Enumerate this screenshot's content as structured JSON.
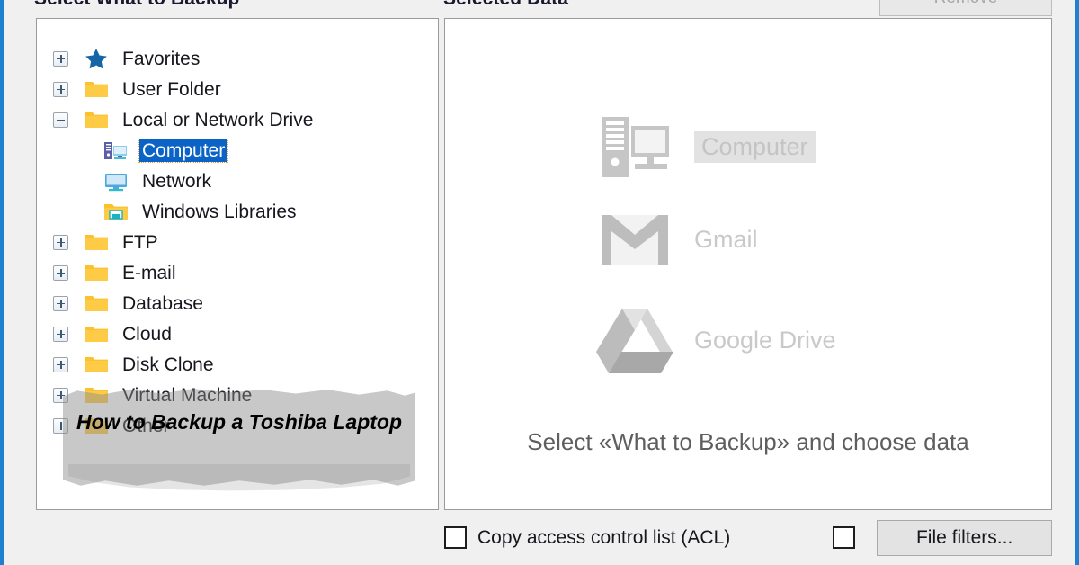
{
  "window": {
    "accent_border_color": "#1f7fd0",
    "background_color": "#f0f0f0"
  },
  "headers": {
    "left": "Select What to Backup",
    "right": "Selected Data"
  },
  "toolbar": {
    "remove_label": "Remove",
    "remove_disabled": true
  },
  "tree": {
    "selection_color": "#0b63c7",
    "items": [
      {
        "label": "Favorites",
        "icon": "star-icon",
        "expander": "plus",
        "level": 0,
        "selected": false
      },
      {
        "label": "User Folder",
        "icon": "folder-icon",
        "expander": "plus",
        "level": 0,
        "selected": false
      },
      {
        "label": "Local or Network Drive",
        "icon": "folder-icon",
        "expander": "minus",
        "level": 0,
        "selected": false
      },
      {
        "label": "Computer",
        "icon": "computer-tower-icon",
        "expander": "none",
        "level": 1,
        "selected": true
      },
      {
        "label": "Network",
        "icon": "monitor-icon",
        "expander": "none",
        "level": 1,
        "selected": false
      },
      {
        "label": "Windows Libraries",
        "icon": "library-folder-icon",
        "expander": "none",
        "level": 1,
        "selected": false
      },
      {
        "label": "FTP",
        "icon": "folder-icon",
        "expander": "plus",
        "level": 0,
        "selected": false
      },
      {
        "label": "E-mail",
        "icon": "folder-icon",
        "expander": "plus",
        "level": 0,
        "selected": false
      },
      {
        "label": "Database",
        "icon": "folder-icon",
        "expander": "plus",
        "level": 0,
        "selected": false
      },
      {
        "label": "Cloud",
        "icon": "folder-icon",
        "expander": "plus",
        "level": 0,
        "selected": false
      },
      {
        "label": "Disk Clone",
        "icon": "folder-icon",
        "expander": "plus",
        "level": 0,
        "selected": false
      },
      {
        "label": "Virtual Machine",
        "icon": "folder-icon",
        "expander": "plus",
        "level": 0,
        "selected": false
      },
      {
        "label": "Other",
        "icon": "folder-icon",
        "expander": "plus",
        "level": 0,
        "selected": false
      }
    ]
  },
  "selected_panel": {
    "hints": [
      {
        "label": "Computer",
        "icon": "computer-tower-icon"
      },
      {
        "label": "Gmail",
        "icon": "gmail-icon"
      },
      {
        "label": "Google Drive",
        "icon": "google-drive-icon"
      }
    ],
    "empty_message": "Select «What to Backup» and choose data",
    "cursor": "arrow-cursor-icon"
  },
  "bottom_bar": {
    "acl_label": "Copy access control list (ACL)",
    "acl_checked": false,
    "filters_checked": false,
    "file_filters_label": "File filters..."
  },
  "overlay": {
    "title": "How to Backup a Toshiba Laptop"
  }
}
